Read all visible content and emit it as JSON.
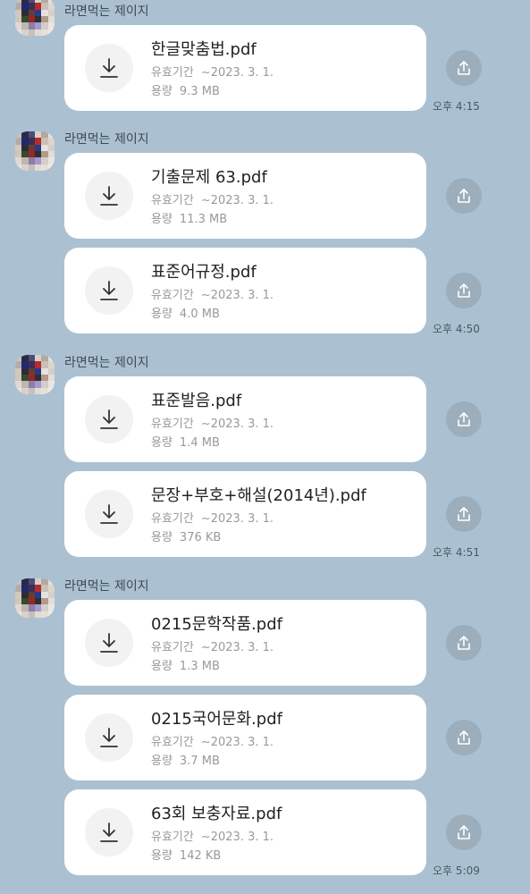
{
  "sender_name": "라면먹는 제이지",
  "expiry_label": "유효기간",
  "size_label": "용량",
  "colors": {
    "background": "#abc1d1",
    "card": "#ffffff",
    "share_button": "#9caebb"
  },
  "icons": {
    "download": "download-icon",
    "share": "share-icon"
  },
  "groups": [
    {
      "time": "오후 4:15",
      "files": [
        {
          "name": "한글맞춤법.pdf",
          "expiry": "~2023. 3. 1.",
          "size": "9.3 MB"
        }
      ]
    },
    {
      "time": "오후 4:50",
      "files": [
        {
          "name": "기출문제 63.pdf",
          "expiry": "~2023. 3. 1.",
          "size": "11.3 MB"
        },
        {
          "name": "표준어규정.pdf",
          "expiry": "~2023. 3. 1.",
          "size": "4.0 MB"
        }
      ]
    },
    {
      "time": "오후 4:51",
      "files": [
        {
          "name": "표준발음.pdf",
          "expiry": "~2023. 3. 1.",
          "size": "1.4 MB"
        },
        {
          "name": "문장+부호+해설(2014년).pdf",
          "expiry": "~2023. 3. 1.",
          "size": "376 KB"
        }
      ]
    },
    {
      "time": "오후 5:09",
      "files": [
        {
          "name": "0215문학작품.pdf",
          "expiry": "~2023. 3. 1.",
          "size": "1.3 MB"
        },
        {
          "name": "0215국어문화.pdf",
          "expiry": "~2023. 3. 1.",
          "size": "3.7 MB"
        },
        {
          "name": "63회 보충자료.pdf",
          "expiry": "~2023. 3. 1.",
          "size": "142 KB"
        }
      ]
    }
  ]
}
